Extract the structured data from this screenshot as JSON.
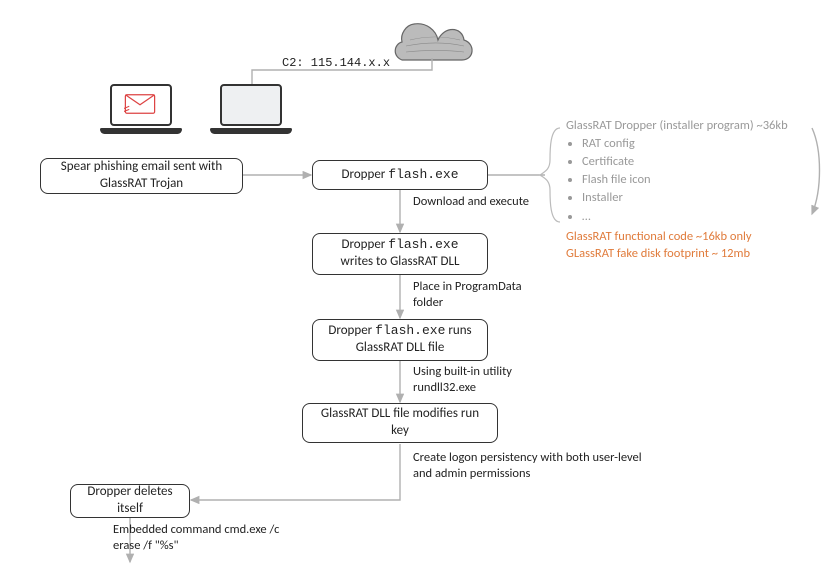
{
  "c2_text": "C2: 115.144.x.x",
  "nodes": {
    "spear": "Spear phishing email sent with GlassRAT Trojan",
    "dropper": "Dropper flash.exe",
    "writes_a": "Dropper",
    "writes_b": "flash.exe",
    "writes_c": "writes to GlassRAT DLL",
    "runs_a": "Dropper",
    "runs_b": "flash.exe",
    "runs_c": "runs GlassRAT DLL file",
    "modifies": "GlassRAT DLL file modifies run key",
    "deletes": "Dropper deletes itself"
  },
  "labels": {
    "download": "Download and execute",
    "place": "Place in ProgramData folder",
    "using": "Using built-in utility rundll32.exe",
    "persist": "Create logon persistency with both user-level and admin permissions",
    "embedded": "Embedded command cmd.exe /c erase /f \"%s\""
  },
  "annot": {
    "title": "GlassRAT Dropper (installer program) ~36kb",
    "items": [
      "RAT config",
      "Certificate",
      "Flash file icon",
      "Installer",
      "…"
    ],
    "orange1": "GlassRAT functional code ~16kb only",
    "orange2": "GLassRAT fake disk footprint ~ 12mb"
  }
}
